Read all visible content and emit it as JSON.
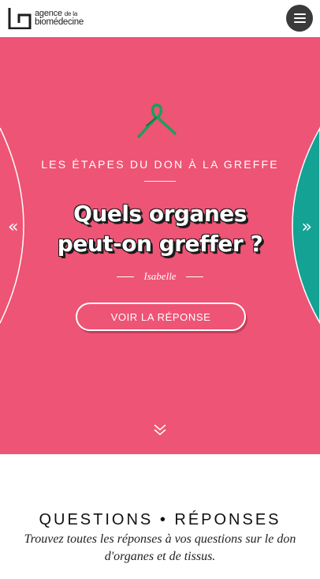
{
  "header": {
    "logo_line1_a": "agence",
    "logo_line1_b": "de la",
    "logo_line2": "biomédecine",
    "menu_icon": "hamburger-icon"
  },
  "hero": {
    "background_color": "#ee5475",
    "right_panel_color": "#13a294",
    "ribbon_color": "#19a05c",
    "prev_arrow": "«",
    "next_arrow": "»",
    "kicker": "LES ÉTAPES DU DON À LA GREFFE",
    "headline_line1": "Quels organes",
    "headline_line2": "peut-on greffer ?",
    "author": "Isabelle",
    "cta_label": "VOIR LA RÉPONSE",
    "scroll_icon": "double-chevron-down-icon"
  },
  "qa": {
    "title": "QUESTIONS • RÉPONSES",
    "subtitle": "Trouvez toutes les réponses à vos questions sur le don d'organes et de tissus."
  }
}
